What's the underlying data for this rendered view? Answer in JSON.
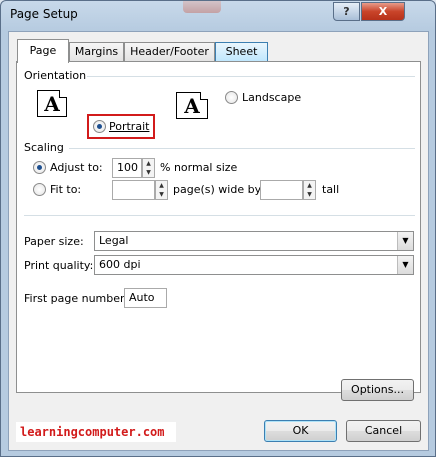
{
  "window": {
    "title": "Page Setup",
    "help": "?",
    "close": "X"
  },
  "tabs": [
    {
      "label": "Page"
    },
    {
      "label": "Margins"
    },
    {
      "label": "Header/Footer"
    },
    {
      "label": "Sheet"
    }
  ],
  "orientation": {
    "heading": "Orientation",
    "portrait_label": "Portrait",
    "landscape_label": "Landscape",
    "selected": "Portrait",
    "glyph": "A"
  },
  "scaling": {
    "heading": "Scaling",
    "adjust_label": "Adjust to:",
    "adjust_value": "100",
    "adjust_suffix": "% normal size",
    "fit_label": "Fit to:",
    "fit_wide_value": "",
    "fit_wide_suffix": "page(s) wide by",
    "fit_tall_value": "",
    "fit_tall_suffix": "tall",
    "selected": "Adjust to"
  },
  "paper": {
    "size_label": "Paper size:",
    "size_value": "Legal",
    "quality_label": "Print quality:",
    "quality_value": "600 dpi",
    "first_page_label": "First page number:",
    "first_page_value": "Auto"
  },
  "buttons": {
    "options": "Options...",
    "ok": "OK",
    "cancel": "Cancel"
  },
  "brand": "learningcomputer.com"
}
